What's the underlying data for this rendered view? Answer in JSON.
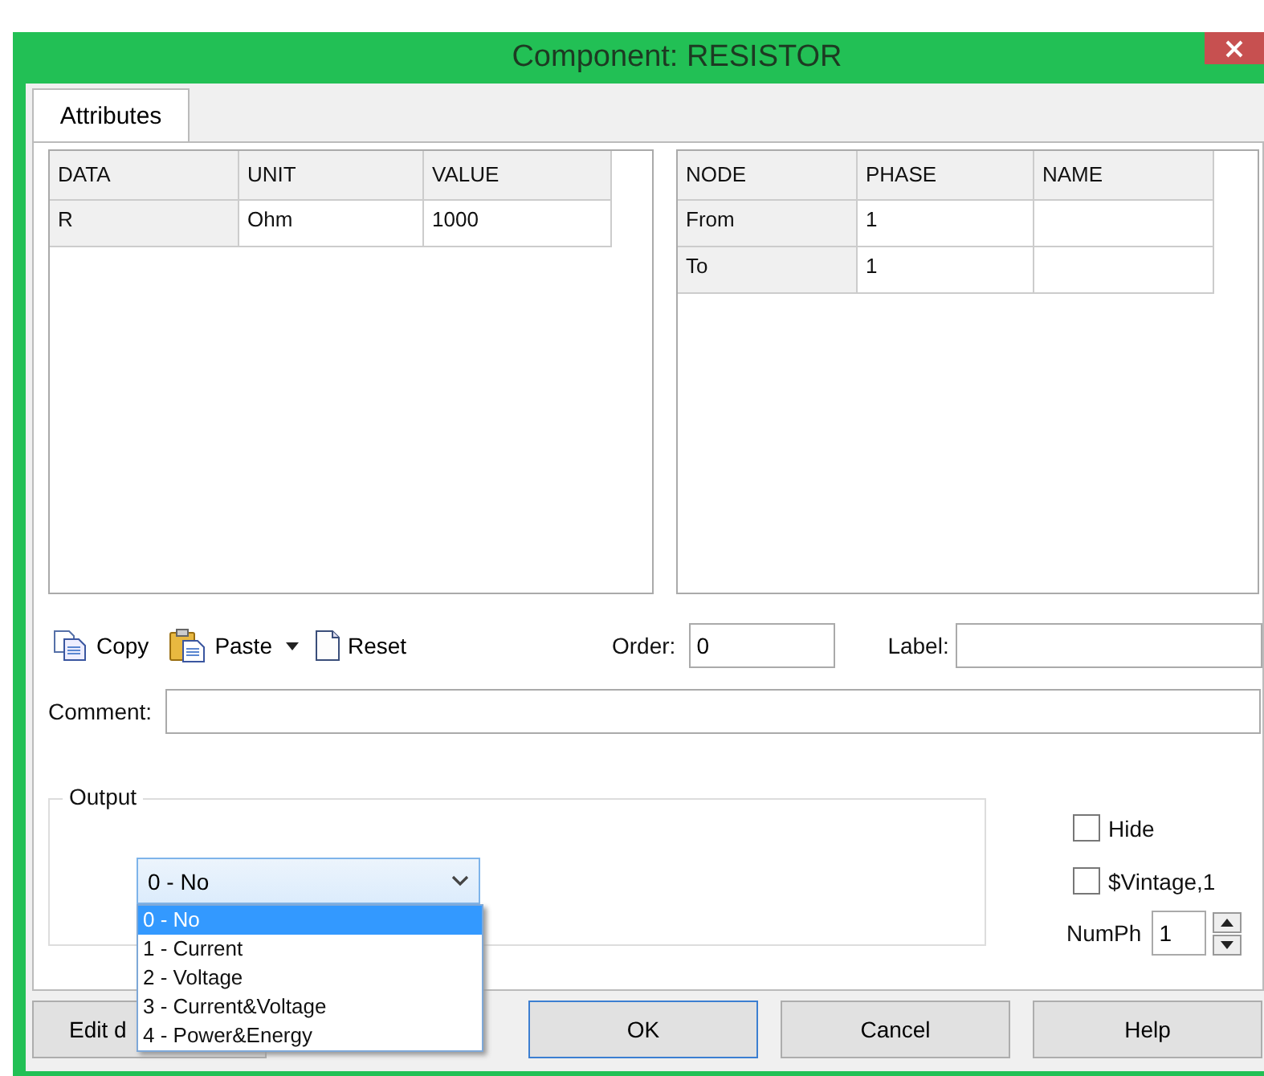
{
  "window": {
    "title": "Component: RESISTOR"
  },
  "tabs": [
    {
      "label": "Attributes",
      "selected": true
    }
  ],
  "data_table": {
    "columns": [
      "DATA",
      "UNIT",
      "VALUE"
    ],
    "rows": [
      [
        "R",
        "Ohm",
        "1000"
      ]
    ]
  },
  "node_table": {
    "columns": [
      "NODE",
      "PHASE",
      "NAME"
    ],
    "rows": [
      [
        "From",
        "1",
        ""
      ],
      [
        "To",
        "1",
        ""
      ]
    ]
  },
  "toolbar": [
    {
      "kind": "copy",
      "label": "Copy"
    },
    {
      "kind": "paste",
      "label": "Paste"
    },
    {
      "kind": "reset",
      "label": "Reset"
    }
  ],
  "order": {
    "label": "Order:",
    "value": "0"
  },
  "label_field": {
    "label": "Label:"
  },
  "comment": {
    "label": "Comment:"
  },
  "output": {
    "legend": "Output",
    "value": "0 - No",
    "expanded": true,
    "options": [
      {
        "label": "0 - No",
        "selected": true
      },
      {
        "label": "1 - Current",
        "selected": false
      },
      {
        "label": "2 - Voltage",
        "selected": false
      },
      {
        "label": "3 - Current&Voltage",
        "selected": false
      },
      {
        "label": "4 - Power&Energy",
        "selected": false
      }
    ]
  },
  "checkboxes": [
    {
      "label": "Hide",
      "checked": false
    },
    {
      "label": "$Vintage,1",
      "checked": false
    }
  ],
  "numph": {
    "label": "NumPh",
    "value": "1"
  },
  "buttons": [
    {
      "label": "Edit d",
      "default": false
    },
    {
      "label": "OK",
      "default": true
    },
    {
      "label": "Cancel",
      "default": false
    },
    {
      "label": "Help",
      "default": false
    }
  ]
}
